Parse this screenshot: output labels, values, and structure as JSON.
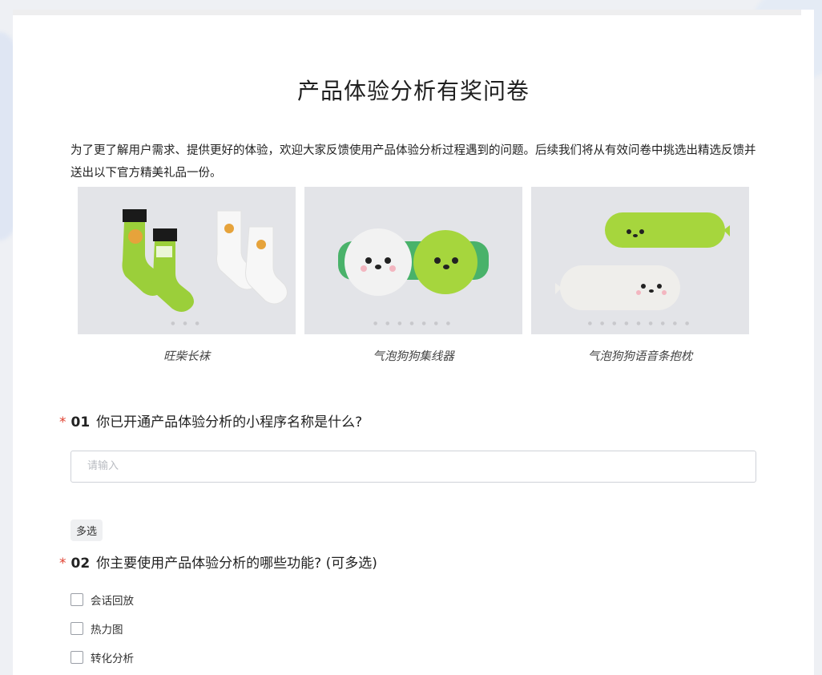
{
  "survey": {
    "title": "产品体验分析有奖问卷",
    "intro": "为了更了解用户需求、提供更好的体验，欢迎大家反馈使用产品体验分析过程遇到的问题。后续我们将从有效问卷中挑选出精选反馈并送出以下官方精美礼品一份。",
    "gifts": [
      {
        "caption": "旺柴长袜",
        "icon": "socks-image"
      },
      {
        "caption": "气泡狗狗集线器",
        "icon": "hub-image"
      },
      {
        "caption": "气泡狗狗语音条抱枕",
        "icon": "pillow-image"
      }
    ],
    "questions": [
      {
        "required_mark": "*",
        "number": "01",
        "text": "你已开通产品体验分析的小程序名称是什么?",
        "input_placeholder": "请输入"
      },
      {
        "tag": "多选",
        "required_mark": "*",
        "number": "02",
        "text": "你主要使用产品体验分析的哪些功能? (可多选)",
        "options": [
          "会话回放",
          "热力图",
          "转化分析"
        ]
      }
    ]
  },
  "colors": {
    "required": "#e0402f",
    "sock_green": "#9bcf3a",
    "plush_green": "#a6d63d",
    "card_bg": "#ffffff"
  }
}
